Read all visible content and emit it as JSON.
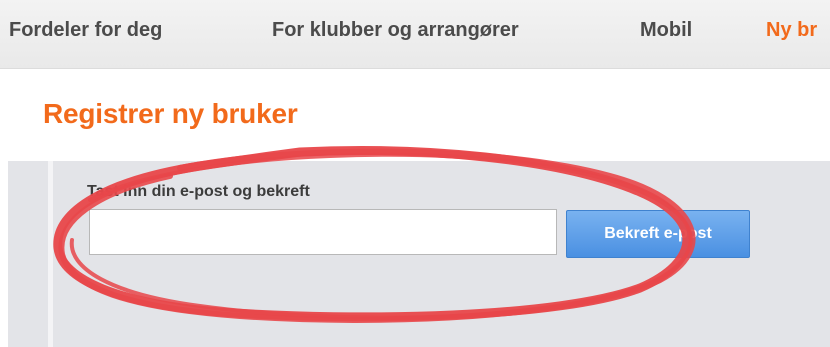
{
  "nav": {
    "items": [
      {
        "label": "Fordeler for deg"
      },
      {
        "label": "For klubber og arrangører"
      },
      {
        "label": "Mobil"
      },
      {
        "label": "Ny br"
      }
    ]
  },
  "page": {
    "title": "Registrer ny bruker"
  },
  "form": {
    "label": "Tast inn din e-post og bekreft",
    "email_value": "",
    "confirm_button_label": "Bekreft e-post"
  },
  "colors": {
    "accent": "#f26a1b",
    "nav_text": "#4b4b4b",
    "panel_bg": "#e3e4e8",
    "button_blue": "#4a90e2",
    "annotation_red": "#e8474a"
  }
}
